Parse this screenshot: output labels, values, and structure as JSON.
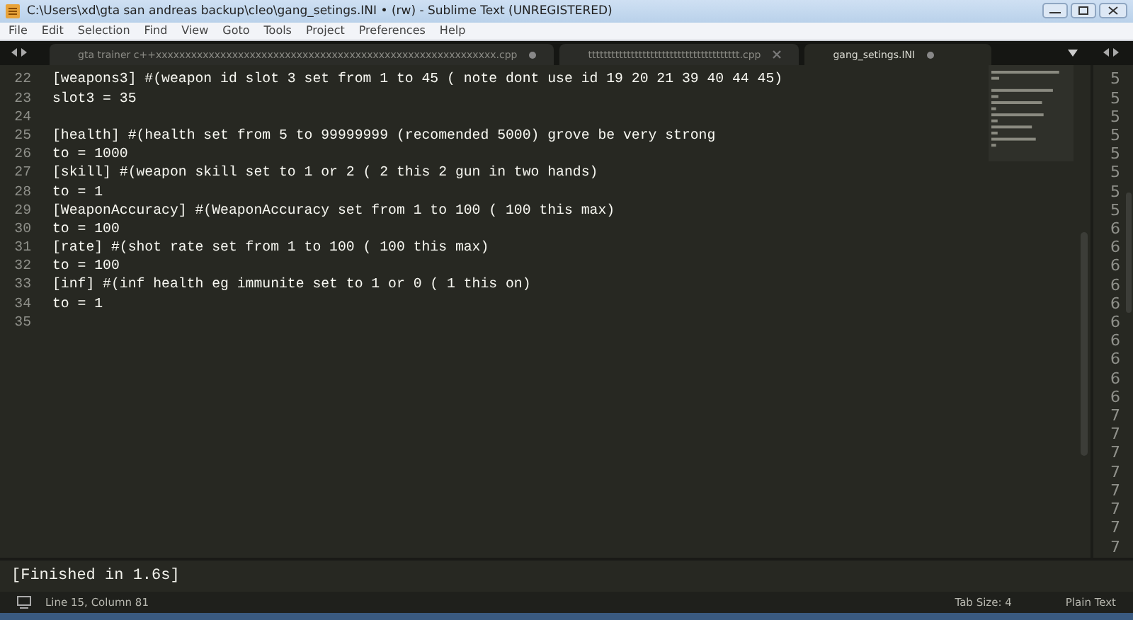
{
  "window": {
    "title": "C:\\Users\\xd\\gta san andreas backup\\cleo\\gang_setings.INI • (rw) - Sublime Text (UNREGISTERED)"
  },
  "menu": [
    "File",
    "Edit",
    "Selection",
    "Find",
    "View",
    "Goto",
    "Tools",
    "Project",
    "Preferences",
    "Help"
  ],
  "tabs": [
    {
      "label": "gta trainer c++xxxxxxxxxxxxxxxxxxxxxxxxxxxxxxxxxxxxxxxxxxxxxxxxxxxxxxxxxx.cpp",
      "selected": false,
      "modified": true
    },
    {
      "label": "ttttttttttttttttttttttttttttttttttttttt.cpp",
      "selected": false,
      "modified": false
    },
    {
      "label": "gang_setings.INI",
      "selected": true,
      "modified": true
    }
  ],
  "editor": {
    "lines": [
      {
        "number": "22",
        "text": "[weapons3] #(weapon id slot 3 set from 1 to 45 ( note dont use id 19 20 21 39 40 44 45)"
      },
      {
        "number": "23",
        "text": "slot3 = 35"
      },
      {
        "number": "24"
      },
      {
        "number": "25",
        "text": "[health] #(health set from 5 to 99999999 (recomended 5000) grove be very strong"
      },
      {
        "number": "26",
        "text": "to = 1000"
      },
      {
        "number": "27",
        "text": "[skill] #(weapon skill set to 1 or 2 ( 2 this 2 gun in two hands)"
      },
      {
        "number": "28",
        "text": "to = 1"
      },
      {
        "number": "29",
        "text": "[WeaponAccuracy] #(WeaponAccuracy set from 1 to 100 ( 100 this max)"
      },
      {
        "number": "30",
        "text": "to = 100"
      },
      {
        "number": "31",
        "text": "[rate] #(shot rate set from 1 to 100 ( 100 this max)"
      },
      {
        "number": "32",
        "text": "to = 100"
      },
      {
        "number": "33",
        "text": "[inf] #(inf health eg immunite set to 1 or 0 ( 1 this on)"
      },
      {
        "number": "34",
        "text": "to = 1"
      },
      {
        "number": "35"
      }
    ]
  },
  "side_pane": {
    "lines": [
      "5",
      "5",
      "5",
      "5",
      "5",
      "5",
      "5",
      "5",
      "6",
      "6",
      "6",
      "6",
      "6",
      "6",
      "6",
      "6",
      "6",
      "6",
      "7",
      "7",
      "7",
      "7",
      "7",
      "7",
      "7",
      "7"
    ]
  },
  "output": "[Finished in 1.6s]",
  "status_bar": {
    "position": "Line 15, Column 81",
    "tab_size": "Tab Size: 4",
    "syntax": "Plain Text"
  }
}
